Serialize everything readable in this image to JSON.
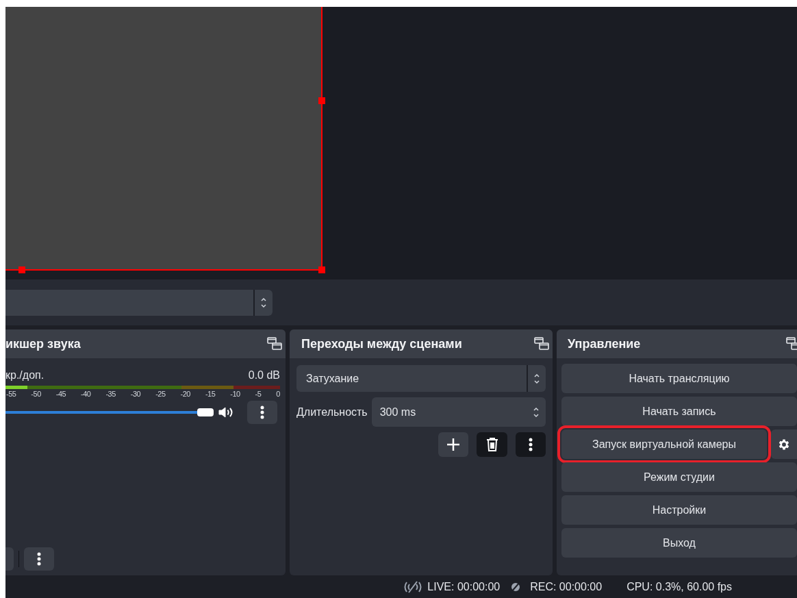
{
  "preview": {
    "source": {
      "selected": true
    }
  },
  "mixer": {
    "title": "икшер звука",
    "channel": {
      "name": "кр./доп.",
      "reading": "0.0 dB",
      "meter": {
        "level": 0.08
      },
      "ticks": [
        "-55",
        "-50",
        "-45",
        "-40",
        "-35",
        "-30",
        "-25",
        "-20",
        "-15",
        "-10",
        "-5",
        "0"
      ],
      "fader": {
        "level": 1
      },
      "muted": false
    }
  },
  "transitions": {
    "title": "Переходы между сценами",
    "transition": "Затухание",
    "duration_label": "Длительность",
    "duration": "300 ms"
  },
  "controls": {
    "title": "Управление",
    "buttons": [
      {
        "label": "Начать трансляцию",
        "highlighted": false,
        "settings": false
      },
      {
        "label": "Начать запись",
        "highlighted": false,
        "settings": false
      },
      {
        "label": "Запуск виртуальной камеры",
        "highlighted": true,
        "settings": true
      },
      {
        "label": "Режим студии",
        "highlighted": false,
        "settings": false
      },
      {
        "label": "Настройки",
        "highlighted": false,
        "settings": false
      },
      {
        "label": "Выход",
        "highlighted": false,
        "settings": false
      }
    ]
  },
  "status_bar": {
    "live": "LIVE: 00:00:00",
    "rec": "REC: 00:00:00",
    "cpu": "CPU: 0.3%, 60.00 fps"
  }
}
